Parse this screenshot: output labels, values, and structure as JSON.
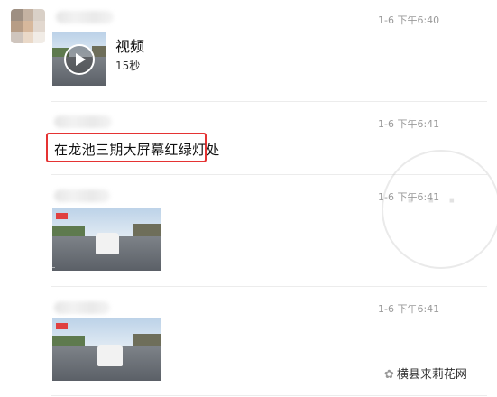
{
  "messages": [
    {
      "time": "1-6 下午6:40",
      "title": "视频",
      "duration": "15秒"
    },
    {
      "time": "1-6 下午6:41",
      "text": "在龙池三期大屏幕红绿灯处"
    },
    {
      "time": "1-6 下午6:41"
    },
    {
      "time": "1-6 下午6:41"
    }
  ],
  "watermark": {
    "text": "横县来莉花网"
  },
  "colors": {
    "highlight_border": "#e53333",
    "time_text": "#9a9a9a",
    "divider": "#ececec"
  }
}
